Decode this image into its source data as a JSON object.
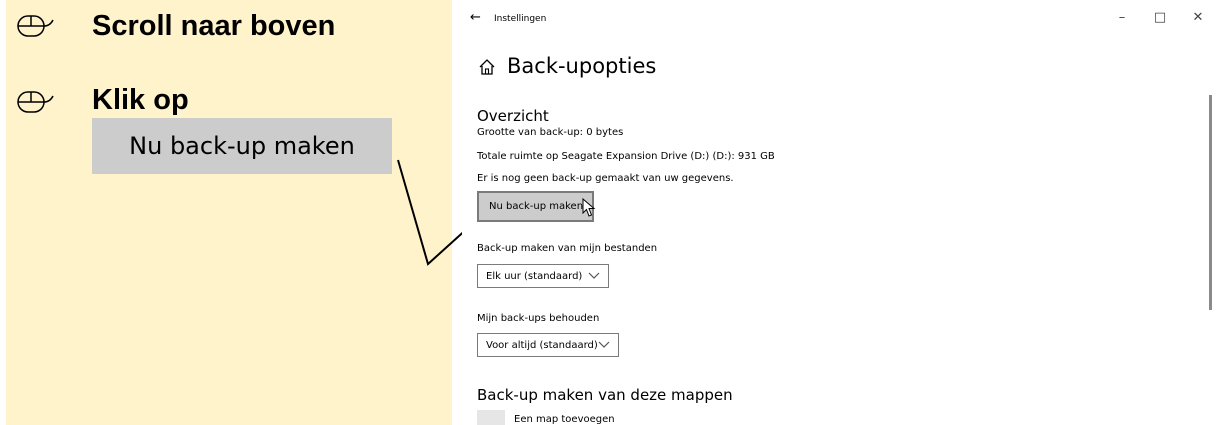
{
  "instructions": {
    "step1": "Scroll naar boven",
    "step2": "Klik op",
    "button_sample": "Nu back-up maken"
  },
  "window": {
    "title": "Instellingen",
    "back_glyph": "←",
    "minimize_glyph": "–",
    "maximize_glyph": "□",
    "close_glyph": "✕",
    "page_title": "Back-upopties"
  },
  "overview": {
    "heading": "Overzicht",
    "size_line": "Grootte van back-up: 0 bytes",
    "space_line": "Totale ruimte op Seagate Expansion Drive (D:) (D:): 931 GB",
    "status_line": "Er is nog geen back-up gemaakt van uw gegevens.",
    "backup_button": "Nu back-up maken"
  },
  "frequency": {
    "label": "Back-up maken van mijn bestanden",
    "value": "Elk uur (standaard)"
  },
  "retention": {
    "label": "Mijn back-ups behouden",
    "value": "Voor altijd (standaard)"
  },
  "folders": {
    "heading": "Back-up maken van deze mappen",
    "add_label": "Een map toevoegen"
  },
  "colors": {
    "panel_bg": "#FFF3CC",
    "button_gray": "#CCCCCC"
  },
  "icons": [
    "mouse-icon",
    "home-icon",
    "chevron-down-icon",
    "cursor-icon",
    "back-arrow-icon"
  ]
}
